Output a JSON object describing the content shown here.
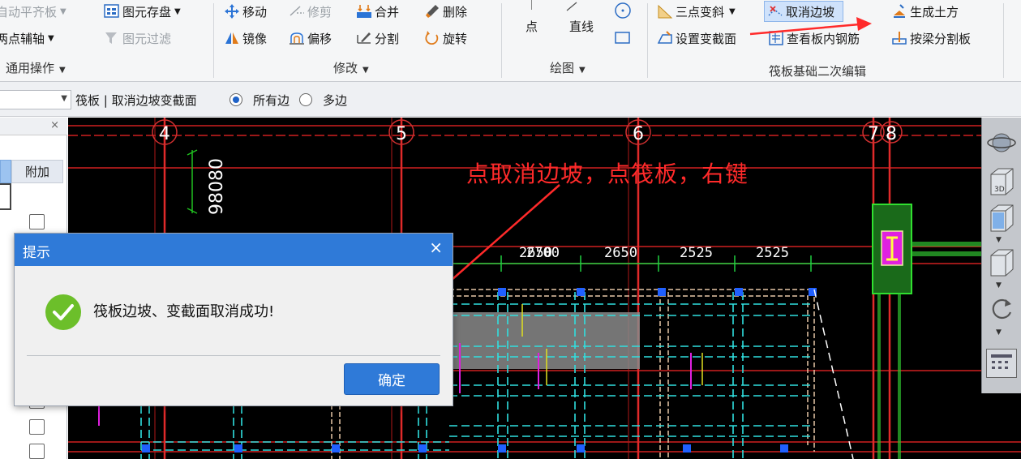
{
  "ribbon": {
    "general": {
      "auto_align_slab": "自动平齐板",
      "two_point_axis": "两点辅轴",
      "save_element": "图元存盘",
      "element_filter": "图元过滤",
      "group_label": "通用操作"
    },
    "modify": {
      "move": "移动",
      "trim": "修剪",
      "merge": "合并",
      "delete": "删除",
      "mirror": "镜像",
      "offset": "偏移",
      "split": "分割",
      "rotate": "旋转",
      "group_label": "修改"
    },
    "draw": {
      "point": "点",
      "line": "直线",
      "group_label": "绘图"
    },
    "raft": {
      "three_point_slope": "三点变斜",
      "cancel_edge_slope": "取消边坡",
      "generate_earthwork": "生成土方",
      "set_section": "设置变截面",
      "view_rebar": "查看板内钢筋",
      "split_by_beam": "按梁分割板",
      "group_label": "筏板基础二次编辑"
    }
  },
  "optionbar": {
    "label": "筏板 | 取消边坡变截面",
    "radio_all": "所有边",
    "radio_multi": "多边"
  },
  "leftpanel": {
    "column_header": "附加"
  },
  "canvas": {
    "axis_labels": [
      "4",
      "5",
      "6",
      "7",
      "8"
    ],
    "dims": [
      "2650",
      "2700",
      "2650",
      "2525",
      "2525"
    ],
    "vertical_dim": "98080"
  },
  "annotation": "点取消边坡，点筏板，右键",
  "dialog": {
    "title": "提示",
    "close": "×",
    "message": "筏板边坡、变截面取消成功!",
    "ok": "确定"
  },
  "colors": {
    "accent": "#2f7ad8",
    "annotation": "#ff2a2a",
    "success": "#6cbf2a"
  }
}
